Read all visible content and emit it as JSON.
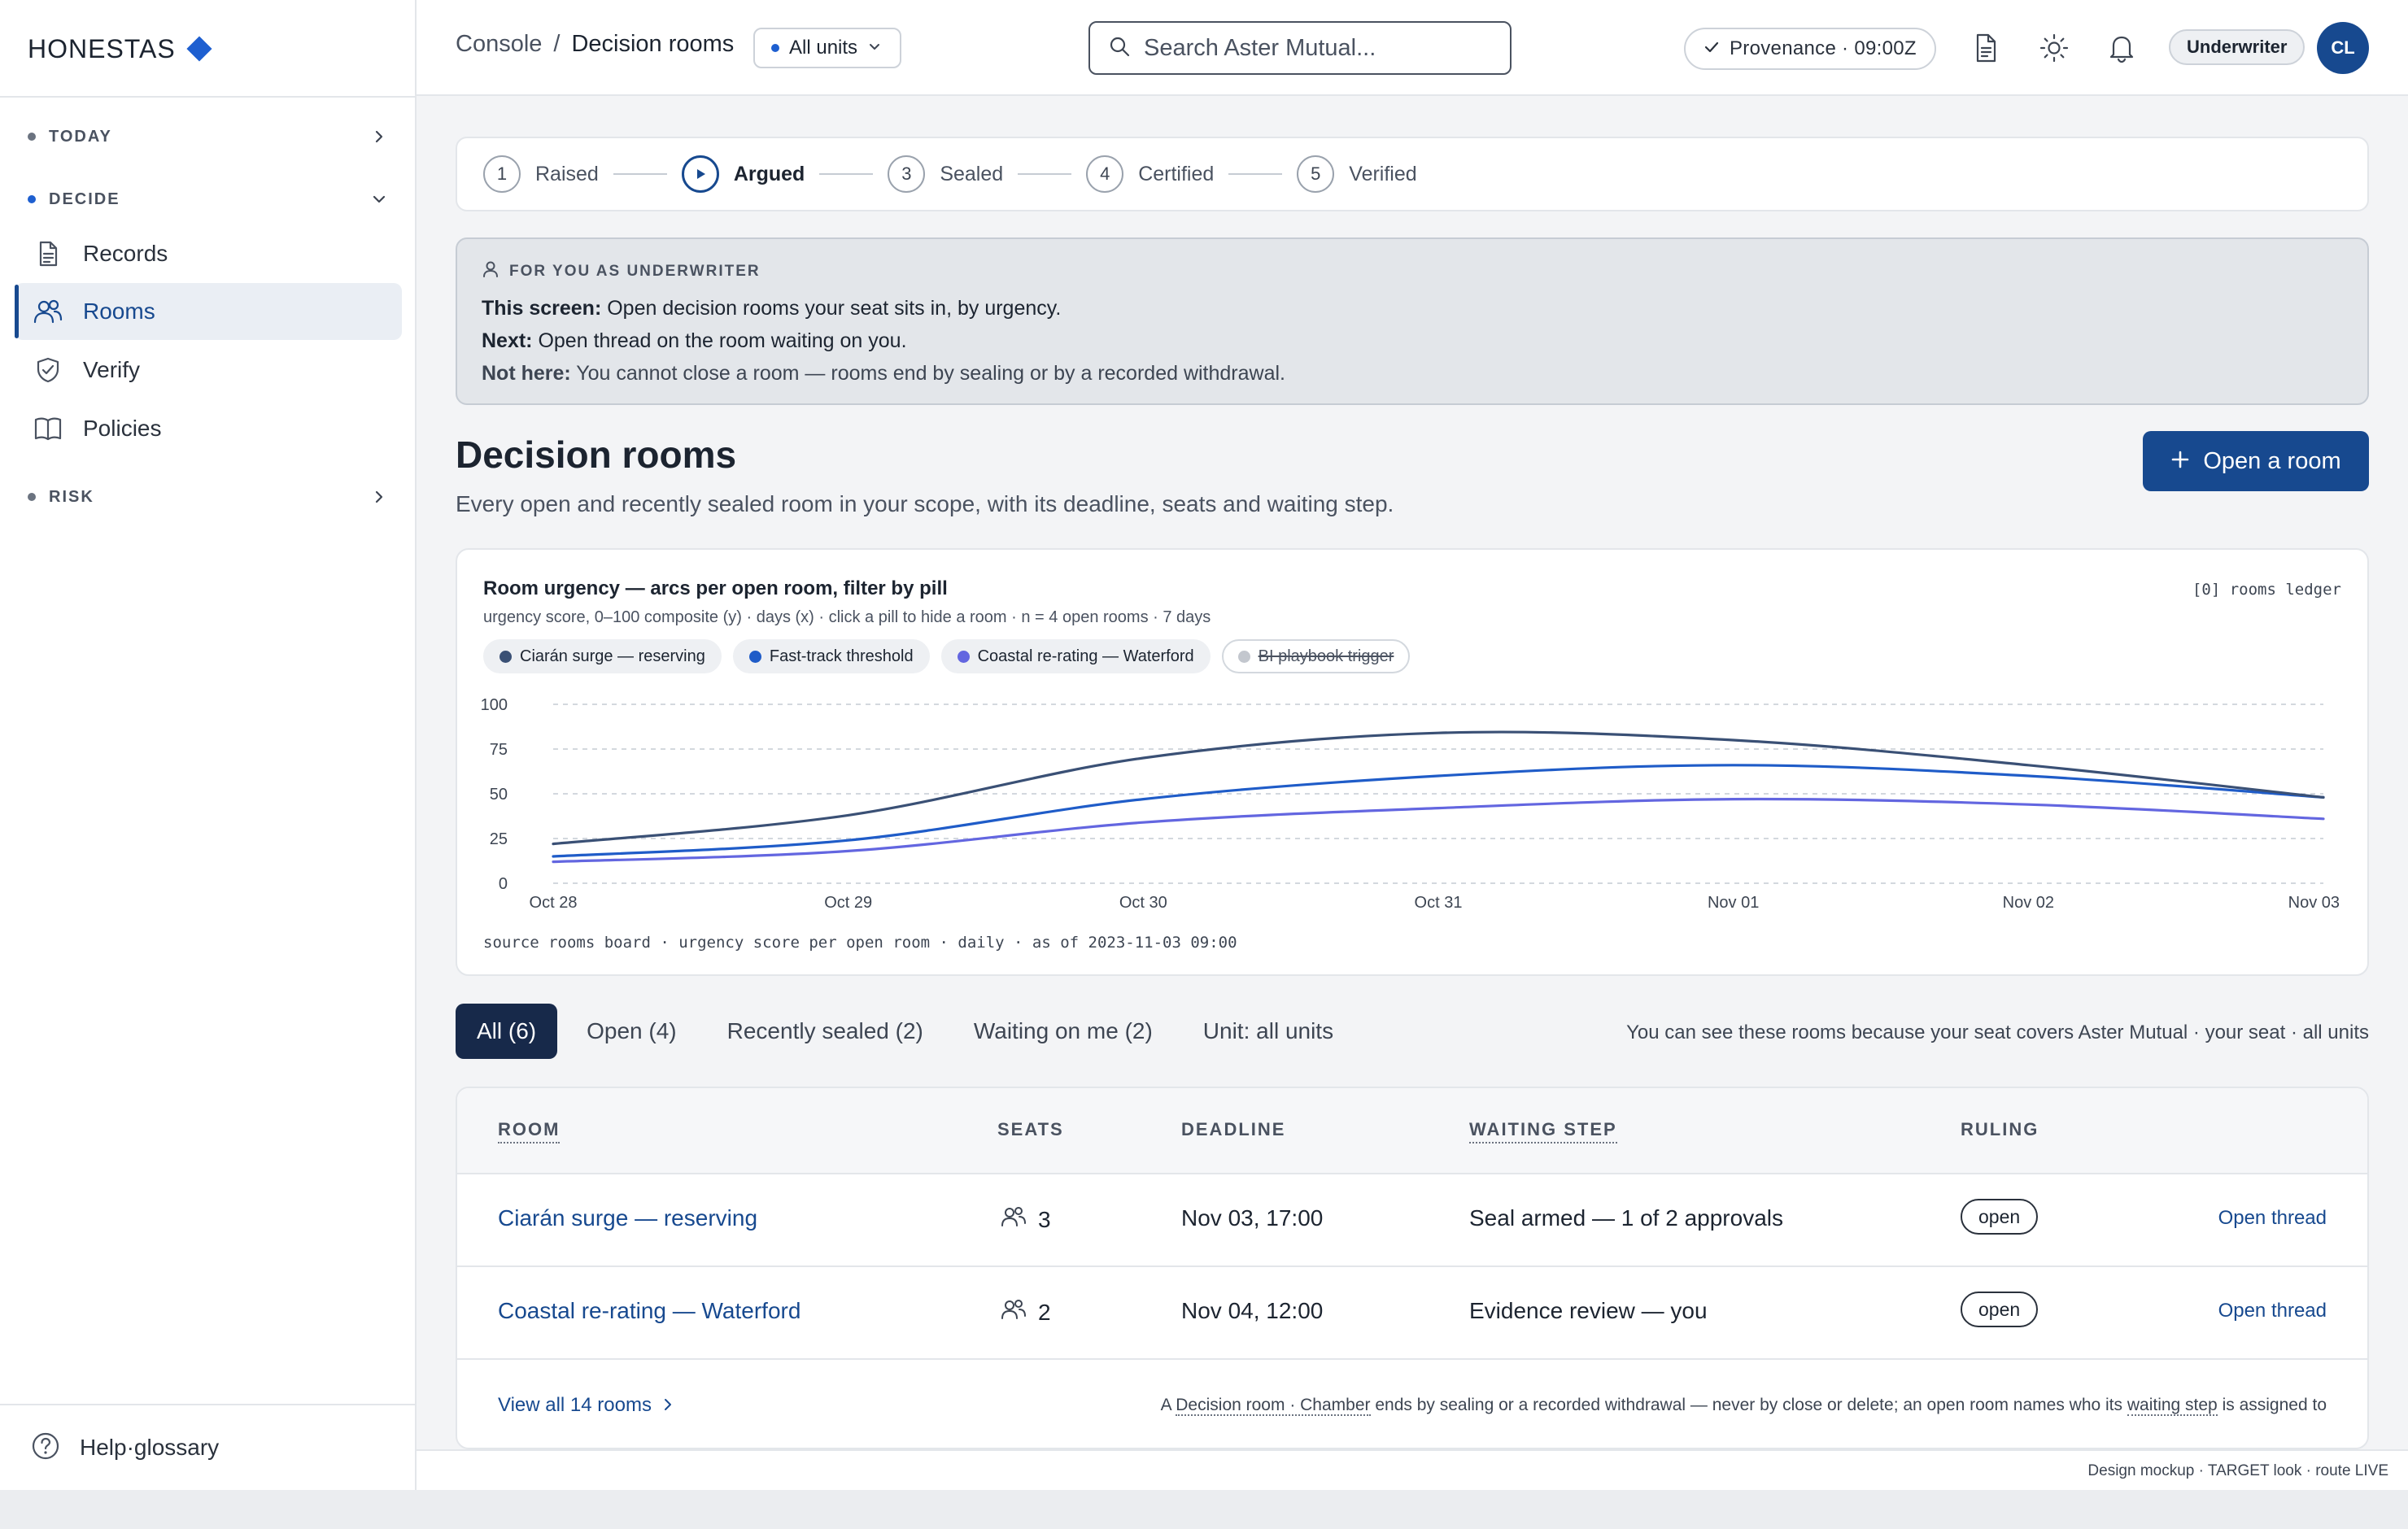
{
  "brand": {
    "name": "HONESTAS"
  },
  "sidebar": {
    "sections": [
      {
        "label": "TODAY",
        "state": "collapsed"
      },
      {
        "label": "DECIDE",
        "state": "expanded"
      },
      {
        "label": "RISK",
        "state": "collapsed"
      }
    ],
    "items": [
      {
        "label": "Records",
        "icon": "document-icon",
        "active": false
      },
      {
        "label": "Rooms",
        "icon": "people-icon",
        "active": true
      },
      {
        "label": "Verify",
        "icon": "shield-check-icon",
        "active": false
      },
      {
        "label": "Policies",
        "icon": "book-icon",
        "active": false
      }
    ],
    "help_label": "Help·glossary"
  },
  "topbar": {
    "breadcrumb": {
      "root": "Console",
      "sep": "/",
      "current": "Decision rooms"
    },
    "unit_select": "All units",
    "search_placeholder": "Search Aster Mutual...",
    "provenance": "Provenance · 09:00Z",
    "role": "Underwriter",
    "avatar_initials": "CL"
  },
  "stepper": {
    "steps": [
      {
        "num": "1",
        "label": "Raised",
        "current": false
      },
      {
        "num": "",
        "label": "Argued",
        "current": true
      },
      {
        "num": "3",
        "label": "Sealed",
        "current": false
      },
      {
        "num": "4",
        "label": "Certified",
        "current": false
      },
      {
        "num": "5",
        "label": "Verified",
        "current": false
      }
    ]
  },
  "callout": {
    "title": "FOR YOU AS UNDERWRITER",
    "lines": [
      {
        "lead": "This screen:",
        "text": " Open decision rooms your seat sits in, by urgency."
      },
      {
        "lead": "Next:",
        "text": " Open thread on the room waiting on you."
      },
      {
        "lead": "Not here:",
        "text": " You cannot close a room — rooms end by sealing or by a recorded withdrawal."
      }
    ]
  },
  "page": {
    "title": "Decision rooms",
    "subtitle": "Every open and recently sealed room in your scope, with its deadline, seats and waiting step.",
    "primary_action": "Open a room"
  },
  "chart_card": {
    "title": "Room urgency — arcs per open room, filter by pill",
    "subtitle": "urgency score, 0–100 composite (y) · days (x) · click a pill to hide a room · n = 4 open rooms · 7 days",
    "ledger": "[0] rooms ledger",
    "source": "source rooms board · urgency score per open room · daily · as of 2023-11-03 09:00"
  },
  "chart_data": {
    "type": "line",
    "x": [
      "Oct 28",
      "Oct 29",
      "Oct 30",
      "Oct 31",
      "Nov 01",
      "Nov 02",
      "Nov 03"
    ],
    "ylim": [
      0,
      100
    ],
    "yticks": [
      0,
      25,
      50,
      75,
      100
    ],
    "grid": true,
    "series": [
      {
        "name": "Ciarán surge — reserving",
        "color": "#3a5075",
        "visible": true,
        "values": [
          22,
          38,
          70,
          84,
          80,
          66,
          48
        ]
      },
      {
        "name": "Fast-track threshold",
        "color": "#1f5cc8",
        "visible": true,
        "values": [
          15,
          24,
          47,
          60,
          66,
          60,
          48
        ]
      },
      {
        "name": "Coastal re-rating — Waterford",
        "color": "#6366e0",
        "visible": true,
        "values": [
          12,
          18,
          34,
          42,
          47,
          44,
          36
        ]
      },
      {
        "name": "BI playbook trigger",
        "color": "#c3c7ce",
        "visible": false,
        "values": []
      }
    ]
  },
  "tabs": [
    {
      "label": "All (6)",
      "active": true
    },
    {
      "label": "Open (4)",
      "active": false
    },
    {
      "label": "Recently sealed (2)",
      "active": false
    },
    {
      "label": "Waiting on me (2)",
      "active": false
    },
    {
      "label": "Unit: all units",
      "active": false
    }
  ],
  "scope_note": "You can see these rooms because your seat covers Aster Mutual · your seat · all units",
  "table": {
    "columns": [
      "ROOM",
      "SEATS",
      "DEADLINE",
      "WAITING STEP",
      "RULING"
    ],
    "rows": [
      {
        "room": "Ciarán surge — reserving",
        "seats": "3",
        "deadline": "Nov 03, 17:00",
        "waiting_step": "Seal armed — 1 of 2 approvals",
        "ruling": "open",
        "action": "Open thread"
      },
      {
        "room": "Coastal re-rating — Waterford",
        "seats": "2",
        "deadline": "Nov 04, 12:00",
        "waiting_step": "Evidence review — you",
        "ruling": "open",
        "action": "Open thread"
      }
    ],
    "view_all": "View all 14 rooms",
    "foot_note": {
      "a": "A ",
      "term": "Decision room · Chamber",
      "b": " ends by sealing or a recorded withdrawal — never by close or delete; an open room names who its ",
      "term2": "waiting step",
      "c": " is assigned to"
    }
  },
  "footer": {
    "mockup_note": "Design mockup · TARGET look · route LIVE"
  },
  "colors": {
    "accent": "#17498f",
    "brand": "#1e5fd0",
    "tab_active": "#17294a"
  }
}
